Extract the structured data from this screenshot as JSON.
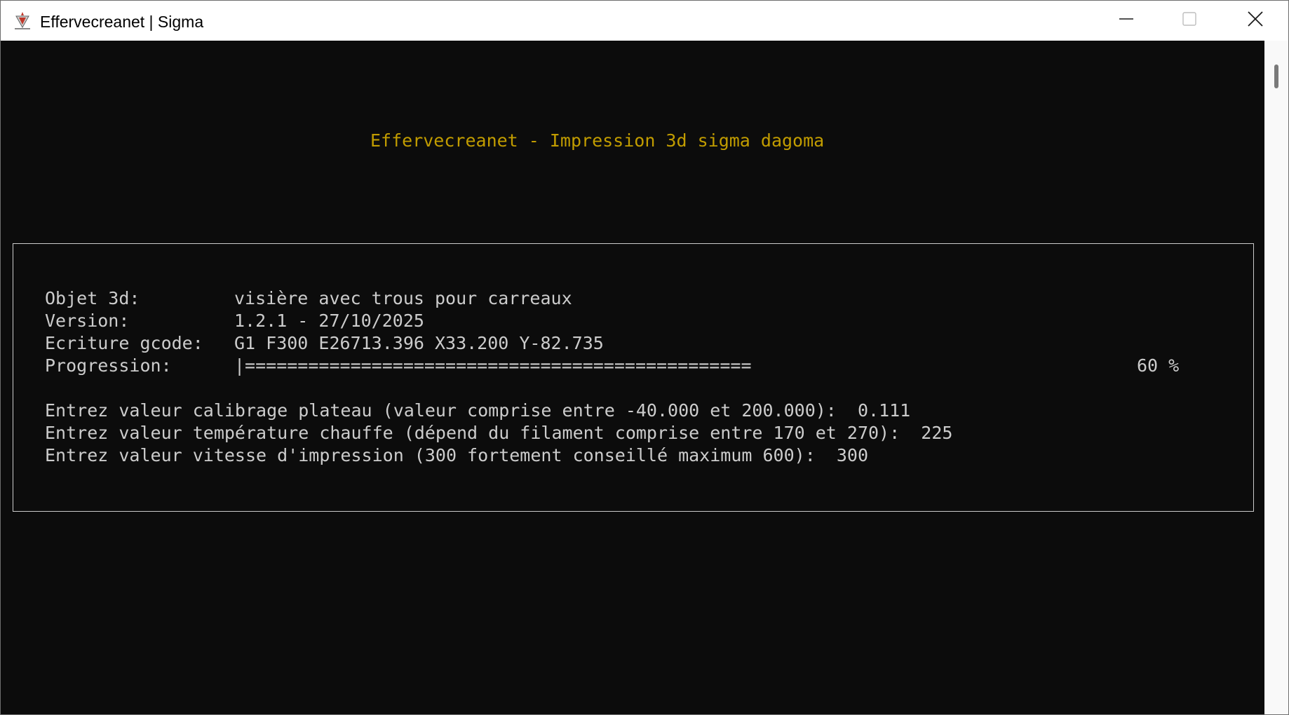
{
  "window": {
    "title": "Effervecreanet | Sigma"
  },
  "console": {
    "header": "Effervecreanet - Impression 3d sigma dagoma",
    "fields": [
      {
        "label": "Objet 3d:",
        "value": "visière avec trous pour carreaux"
      },
      {
        "label": "Version:",
        "value": "1.2.1 - 27/10/2025"
      },
      {
        "label": "Ecriture gcode:",
        "value": "G1 F300 E26713.396 X33.200 Y-82.735"
      }
    ],
    "progress": {
      "label": "Progression:",
      "bar": "|================================================",
      "percent_text": "60 %",
      "percent": 60
    },
    "prompts": [
      {
        "text": "Entrez valeur calibrage plateau (valeur comprise entre -40.000 et 200.000):",
        "answer": "0.111"
      },
      {
        "text": "Entrez valeur température chauffe (dépend du filament comprise entre 170 et 270):",
        "answer": "225"
      },
      {
        "text": "Entrez valeur vitesse d'impression (300 fortement conseillé maximum 600):",
        "answer": "300"
      }
    ]
  },
  "colors": {
    "header": "#c19c00",
    "text": "#cccccc",
    "background": "#0c0c0c"
  }
}
